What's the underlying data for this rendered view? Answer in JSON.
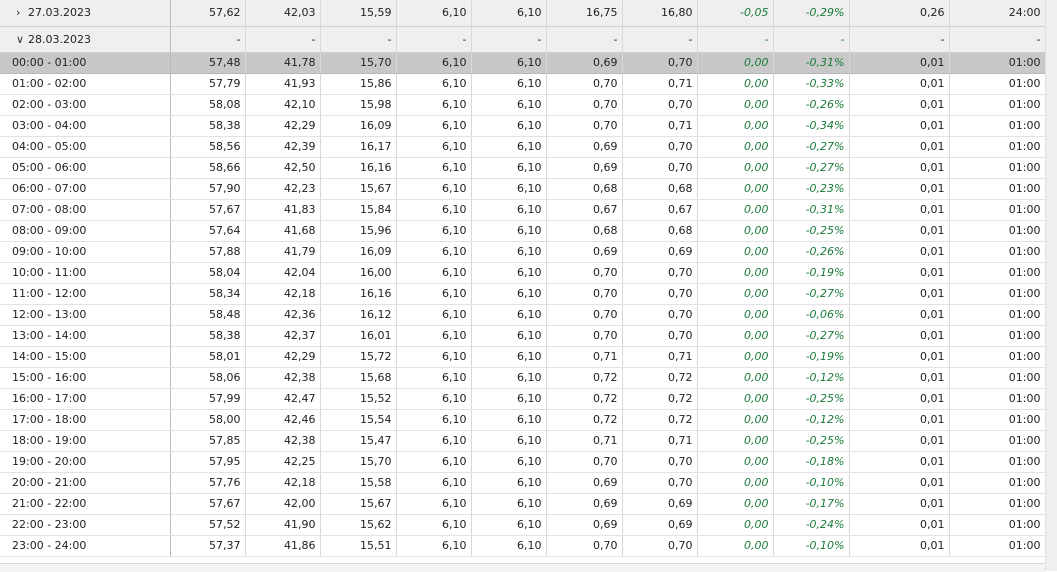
{
  "rows": [
    {
      "kind": "date",
      "collapsed": true,
      "label": "27.03.2023",
      "values": [
        "57,62",
        "42,03",
        "15,59",
        "6,10",
        "6,10",
        "16,75",
        "16,80",
        "-0,05",
        "-0,29%",
        "0,26",
        "24:00"
      ]
    },
    {
      "kind": "date",
      "collapsed": false,
      "label": "28.03.2023",
      "values": [
        "-",
        "-",
        "-",
        "-",
        "-",
        "-",
        "-",
        "-",
        "-",
        "-",
        "-"
      ]
    },
    {
      "kind": "hour",
      "selected": true,
      "label": "00:00 - 01:00",
      "values": [
        "57,48",
        "41,78",
        "15,70",
        "6,10",
        "6,10",
        "0,69",
        "0,70",
        "0,00",
        "-0,31%",
        "0,01",
        "01:00"
      ]
    },
    {
      "kind": "hour",
      "label": "01:00 - 02:00",
      "values": [
        "57,79",
        "41,93",
        "15,86",
        "6,10",
        "6,10",
        "0,70",
        "0,71",
        "0,00",
        "-0,33%",
        "0,01",
        "01:00"
      ]
    },
    {
      "kind": "hour",
      "label": "02:00 - 03:00",
      "values": [
        "58,08",
        "42,10",
        "15,98",
        "6,10",
        "6,10",
        "0,70",
        "0,70",
        "0,00",
        "-0,26%",
        "0,01",
        "01:00"
      ]
    },
    {
      "kind": "hour",
      "label": "03:00 - 04:00",
      "values": [
        "58,38",
        "42,29",
        "16,09",
        "6,10",
        "6,10",
        "0,70",
        "0,71",
        "0,00",
        "-0,34%",
        "0,01",
        "01:00"
      ]
    },
    {
      "kind": "hour",
      "label": "04:00 - 05:00",
      "values": [
        "58,56",
        "42,39",
        "16,17",
        "6,10",
        "6,10",
        "0,69",
        "0,70",
        "0,00",
        "-0,27%",
        "0,01",
        "01:00"
      ]
    },
    {
      "kind": "hour",
      "label": "05:00 - 06:00",
      "values": [
        "58,66",
        "42,50",
        "16,16",
        "6,10",
        "6,10",
        "0,69",
        "0,70",
        "0,00",
        "-0,27%",
        "0,01",
        "01:00"
      ]
    },
    {
      "kind": "hour",
      "label": "06:00 - 07:00",
      "values": [
        "57,90",
        "42,23",
        "15,67",
        "6,10",
        "6,10",
        "0,68",
        "0,68",
        "0,00",
        "-0,23%",
        "0,01",
        "01:00"
      ]
    },
    {
      "kind": "hour",
      "label": "07:00 - 08:00",
      "values": [
        "57,67",
        "41,83",
        "15,84",
        "6,10",
        "6,10",
        "0,67",
        "0,67",
        "0,00",
        "-0,31%",
        "0,01",
        "01:00"
      ]
    },
    {
      "kind": "hour",
      "label": "08:00 - 09:00",
      "values": [
        "57,64",
        "41,68",
        "15,96",
        "6,10",
        "6,10",
        "0,68",
        "0,68",
        "0,00",
        "-0,25%",
        "0,01",
        "01:00"
      ]
    },
    {
      "kind": "hour",
      "label": "09:00 - 10:00",
      "values": [
        "57,88",
        "41,79",
        "16,09",
        "6,10",
        "6,10",
        "0,69",
        "0,69",
        "0,00",
        "-0,26%",
        "0,01",
        "01:00"
      ]
    },
    {
      "kind": "hour",
      "label": "10:00 - 11:00",
      "values": [
        "58,04",
        "42,04",
        "16,00",
        "6,10",
        "6,10",
        "0,70",
        "0,70",
        "0,00",
        "-0,19%",
        "0,01",
        "01:00"
      ]
    },
    {
      "kind": "hour",
      "label": "11:00 - 12:00",
      "values": [
        "58,34",
        "42,18",
        "16,16",
        "6,10",
        "6,10",
        "0,70",
        "0,70",
        "0,00",
        "-0,27%",
        "0,01",
        "01:00"
      ]
    },
    {
      "kind": "hour",
      "label": "12:00 - 13:00",
      "values": [
        "58,48",
        "42,36",
        "16,12",
        "6,10",
        "6,10",
        "0,70",
        "0,70",
        "0,00",
        "-0,06%",
        "0,01",
        "01:00"
      ]
    },
    {
      "kind": "hour",
      "label": "13:00 - 14:00",
      "values": [
        "58,38",
        "42,37",
        "16,01",
        "6,10",
        "6,10",
        "0,70",
        "0,70",
        "0,00",
        "-0,27%",
        "0,01",
        "01:00"
      ]
    },
    {
      "kind": "hour",
      "label": "14:00 - 15:00",
      "values": [
        "58,01",
        "42,29",
        "15,72",
        "6,10",
        "6,10",
        "0,71",
        "0,71",
        "0,00",
        "-0,19%",
        "0,01",
        "01:00"
      ]
    },
    {
      "kind": "hour",
      "label": "15:00 - 16:00",
      "values": [
        "58,06",
        "42,38",
        "15,68",
        "6,10",
        "6,10",
        "0,72",
        "0,72",
        "0,00",
        "-0,12%",
        "0,01",
        "01:00"
      ]
    },
    {
      "kind": "hour",
      "label": "16:00 - 17:00",
      "values": [
        "57,99",
        "42,47",
        "15,52",
        "6,10",
        "6,10",
        "0,72",
        "0,72",
        "0,00",
        "-0,25%",
        "0,01",
        "01:00"
      ]
    },
    {
      "kind": "hour",
      "label": "17:00 - 18:00",
      "values": [
        "58,00",
        "42,46",
        "15,54",
        "6,10",
        "6,10",
        "0,72",
        "0,72",
        "0,00",
        "-0,12%",
        "0,01",
        "01:00"
      ]
    },
    {
      "kind": "hour",
      "label": "18:00 - 19:00",
      "values": [
        "57,85",
        "42,38",
        "15,47",
        "6,10",
        "6,10",
        "0,71",
        "0,71",
        "0,00",
        "-0,25%",
        "0,01",
        "01:00"
      ]
    },
    {
      "kind": "hour",
      "label": "19:00 - 20:00",
      "values": [
        "57,95",
        "42,25",
        "15,70",
        "6,10",
        "6,10",
        "0,70",
        "0,70",
        "0,00",
        "-0,18%",
        "0,01",
        "01:00"
      ]
    },
    {
      "kind": "hour",
      "label": "20:00 - 21:00",
      "values": [
        "57,76",
        "42,18",
        "15,58",
        "6,10",
        "6,10",
        "0,69",
        "0,70",
        "0,00",
        "-0,10%",
        "0,01",
        "01:00"
      ]
    },
    {
      "kind": "hour",
      "label": "21:00 - 22:00",
      "values": [
        "57,67",
        "42,00",
        "15,67",
        "6,10",
        "6,10",
        "0,69",
        "0,69",
        "0,00",
        "-0,17%",
        "0,01",
        "01:00"
      ]
    },
    {
      "kind": "hour",
      "label": "22:00 - 23:00",
      "values": [
        "57,52",
        "41,90",
        "15,62",
        "6,10",
        "6,10",
        "0,69",
        "0,69",
        "0,00",
        "-0,24%",
        "0,01",
        "01:00"
      ]
    },
    {
      "kind": "hour",
      "label": "23:00 - 24:00",
      "values": [
        "57,37",
        "41,86",
        "15,51",
        "6,10",
        "6,10",
        "0,70",
        "0,70",
        "0,00",
        "-0,10%",
        "0,01",
        "01:00"
      ]
    }
  ],
  "icons": {
    "expand": "chevron-right-icon",
    "collapse": "chevron-down-icon"
  },
  "colors": {
    "change_text": "#1a7a3a",
    "selected_row": "#c8c8c8",
    "date_row": "#efefef"
  }
}
